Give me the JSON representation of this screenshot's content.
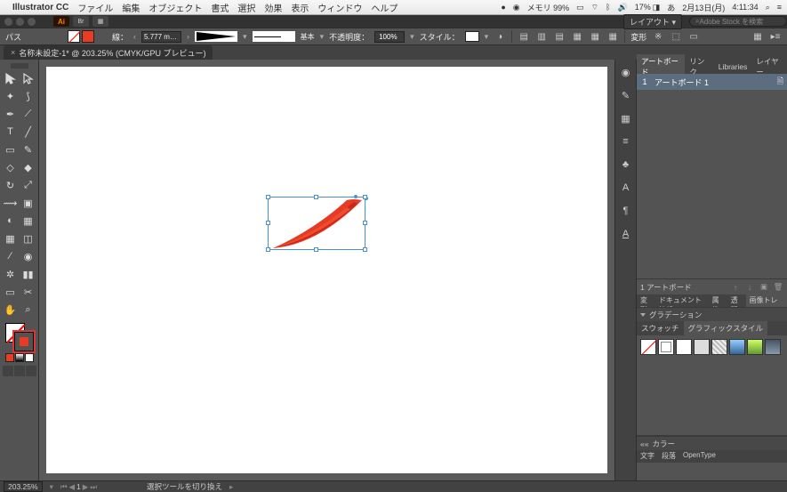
{
  "menubar": {
    "app": "Illustrator CC",
    "items": [
      "ファイル",
      "編集",
      "オブジェクト",
      "書式",
      "選択",
      "効果",
      "表示",
      "ウィンドウ",
      "ヘルプ"
    ],
    "battery": "17%",
    "date": "2月13日(月)",
    "time": "4:11:34",
    "mem": "メモリ 99%"
  },
  "appbar": {
    "layout_label": "レイアウト ▾",
    "search_placeholder": "Adobe Stock を検索"
  },
  "control": {
    "path_label": "パス",
    "stroke_label": "線：",
    "stroke_width": "5.777 m…",
    "basic_label": "基本",
    "opacity_label": "不透明度：",
    "opacity_value": "100%",
    "style_label": "スタイル：",
    "transform_label": "変形"
  },
  "tab": {
    "title": "名称未設定-1* @ 203.25% (CMYK/GPU プレビュー)",
    "close": "×"
  },
  "panels": {
    "artboard_tabs": [
      "アートボード",
      "リンク",
      "Libraries",
      "レイヤー"
    ],
    "artboard_row": {
      "num": "1",
      "name": "アートボード 1"
    },
    "artboard_count": "1 アートボード",
    "prop_tabs": [
      "変形",
      "ドキュメント情報",
      "属性",
      "透明",
      "画像トレース"
    ],
    "gradient": "グラデーション",
    "swatch_tabs": [
      "スウォッチ",
      "グラフィックスタイル"
    ],
    "color": "カラー",
    "type_tabs": [
      "文字",
      "段落",
      "OpenType"
    ]
  },
  "status": {
    "zoom": "203.25%",
    "page": "1",
    "tool_hint": "選択ツールを切り換え"
  }
}
